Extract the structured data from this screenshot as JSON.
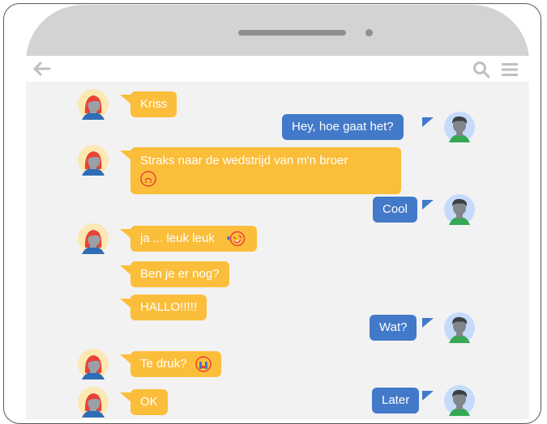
{
  "messages": [
    {
      "side": "left",
      "text": "Kriss"
    },
    {
      "side": "right",
      "text": "Hey, hoe gaat het?"
    },
    {
      "side": "left",
      "text": "Straks naar de wedstrijd van m'n broer"
    },
    {
      "side": "right",
      "text": "Cool"
    },
    {
      "side": "left",
      "text": "ja ... leuk leuk"
    },
    {
      "side": "left",
      "text": "Ben je er nog?"
    },
    {
      "side": "left",
      "text": "HALLO!!!!!"
    },
    {
      "side": "right",
      "text": "Wat?"
    },
    {
      "side": "left",
      "text": "Te druk?"
    },
    {
      "side": "left",
      "text": "OK"
    },
    {
      "side": "right",
      "text": "Later"
    }
  ],
  "emoji": {
    "upside_down": "upside-down-face-emoji",
    "laughing": "rolling-laughing-emoji",
    "crying": "crying-face-emoji"
  },
  "colors": {
    "left_bubble": "#fbbe3b",
    "right_bubble": "#4279c8",
    "chat_background": "#f2f2f2",
    "phone_shell": "#d3d3d3"
  },
  "icons": {
    "back": "back-arrow-icon",
    "search": "search-icon",
    "menu": "menu-icon"
  }
}
